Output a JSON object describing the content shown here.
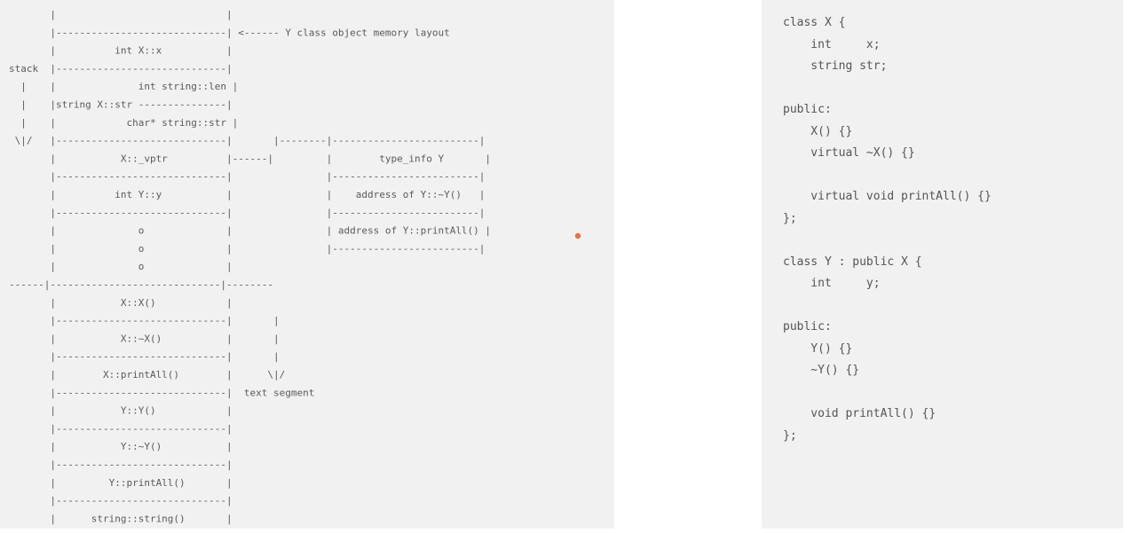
{
  "diagram": {
    "lines": [
      "       |                             |",
      "       |-----------------------------| <------ Y class object memory layout",
      "       |          int X::x           |",
      "stack  |-----------------------------|",
      "  |    |              int string::len |",
      "  |    |string X::str ---------------|",
      "  |    |            char* string::str |",
      " \\|/   |-----------------------------|       |--------|-------------------------|",
      "       |           X::_vptr          |------|         |        type_info Y       |",
      "       |-----------------------------|                |-------------------------|",
      "       |          int Y::y           |                |    address of Y::~Y()   |",
      "       |-----------------------------|                |-------------------------|",
      "       |              o              |                | address of Y::printAll() |",
      "       |              o              |                |-------------------------|",
      "       |              o              |",
      "------|-----------------------------|--------",
      "       |           X::X()            |",
      "       |-----------------------------|       |",
      "       |           X::~X()           |       |",
      "       |-----------------------------|       |",
      "       |        X::printAll()        |      \\|/",
      "       |-----------------------------|  text segment",
      "       |           Y::Y()            |",
      "       |-----------------------------|",
      "       |           Y::~Y()           |",
      "       |-----------------------------|",
      "       |         Y::printAll()       |",
      "       |-----------------------------|",
      "       |      string::string()       |"
    ],
    "marker_color": "#e8703a"
  },
  "code": {
    "lines": [
      "class X {",
      "    int     x;",
      "    string str;",
      "",
      "public:",
      "    X() {}",
      "    virtual ~X() {}",
      "",
      "    virtual void printAll() {}",
      "};",
      "",
      "class Y : public X {",
      "    int     y;",
      "",
      "public:",
      "    Y() {}",
      "    ~Y() {}",
      "",
      "    void printAll() {}",
      "};"
    ]
  }
}
